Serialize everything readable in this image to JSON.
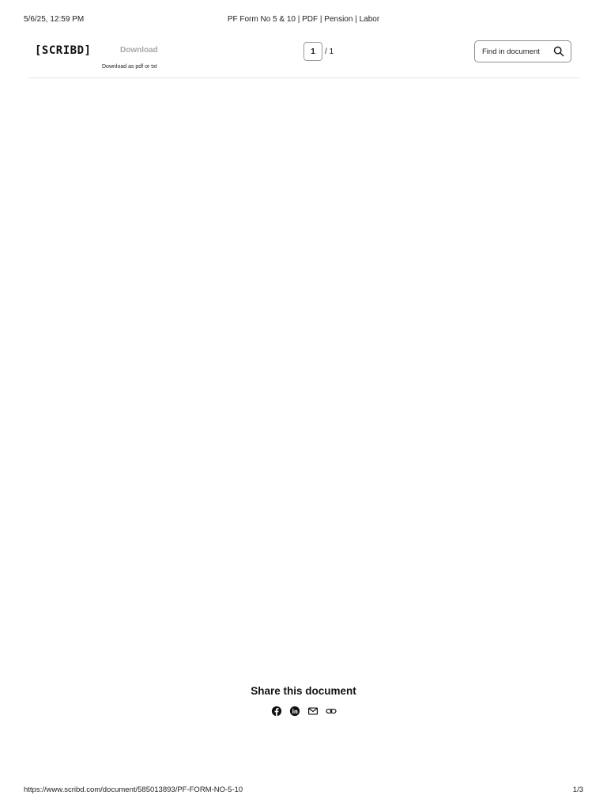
{
  "print_header": {
    "date": "5/6/25, 12:59 PM",
    "title": "PF Form No 5 & 10 | PDF | Pension | Labor"
  },
  "topbar": {
    "logo": "[SCRIBD]",
    "download_label": "Download",
    "download_sub": "Download as pdf or txt",
    "page_current": "1",
    "page_total": "/ 1",
    "find_label": "Find in document"
  },
  "share": {
    "title": "Share this document",
    "icons": [
      "facebook-icon",
      "linkedin-icon",
      "email-icon",
      "link-icon"
    ]
  },
  "print_footer": {
    "url": "https://www.scribd.com/document/585013893/PF-FORM-NO-5-10",
    "page_count": "1/3"
  }
}
